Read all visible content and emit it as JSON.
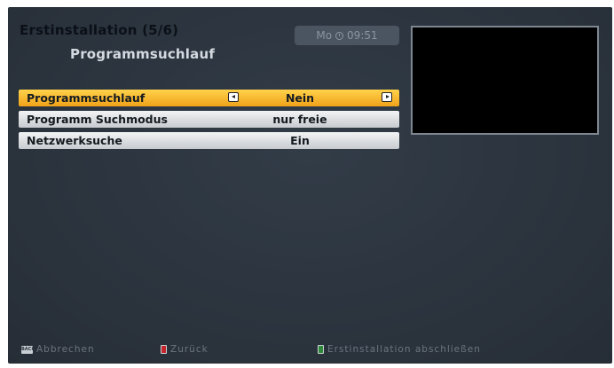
{
  "header": {
    "title": "Erstinstallation (5/6)",
    "subtitle": "Programmsuchlauf",
    "clock": {
      "day": "Mo",
      "time": "09:51"
    }
  },
  "menu": {
    "items": [
      {
        "label": "Programmsuchlauf",
        "value": "Nein",
        "active": true
      },
      {
        "label": "Programm Suchmodus",
        "value": "nur freie",
        "active": false
      },
      {
        "label": "Netzwerksuche",
        "value": "Ein",
        "active": false
      }
    ]
  },
  "footer": {
    "back": {
      "icon_text": "BACK",
      "label": "Abbrechen"
    },
    "red": {
      "label": "Zurück",
      "color": "#c3262c"
    },
    "green": {
      "label": "Erstinstallation abschließen",
      "color": "#2e8a3a"
    }
  },
  "colors": {
    "background": "#2c3540",
    "highlight": "#f0a21a"
  }
}
